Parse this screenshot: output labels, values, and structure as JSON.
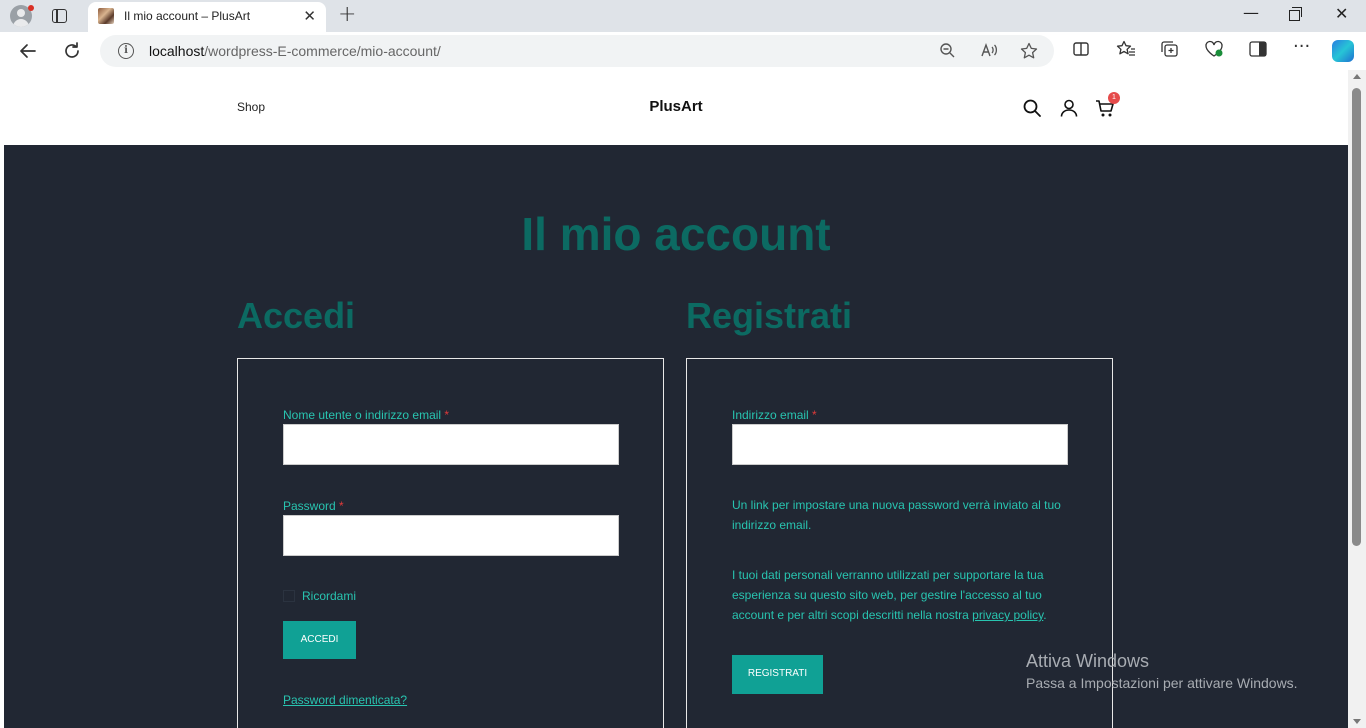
{
  "browser": {
    "tab_title": "Il mio account – PlusArt",
    "tab_close": "✕",
    "new_tab": "+",
    "url_host": "localhost",
    "url_path": "/wordpress-E-commerce/mio-account/",
    "window_controls": {
      "minimize": "—",
      "close": "✕"
    }
  },
  "site": {
    "nav": {
      "shop": "Shop"
    },
    "brand": "PlusArt",
    "cart_count": "1",
    "icons": [
      "search-icon",
      "user-icon",
      "cart-icon"
    ]
  },
  "page": {
    "title": "Il mio account",
    "login": {
      "heading": "Accedi",
      "username_label": "Nome utente o indirizzo email",
      "password_label": "Password",
      "required_mark": "*",
      "remember_label": "Ricordami",
      "submit_label": "ACCEDI",
      "lost_password": "Password dimenticata?"
    },
    "register": {
      "heading": "Registrati",
      "email_label": "Indirizzo email",
      "required_mark": "*",
      "password_note": "Un link per impostare una nuova password verrà inviato al tuo indirizzo email.",
      "privacy_text": "I tuoi dati personali verranno utilizzati per supportare la tua esperienza su questo sito web, per gestire l'accesso al tuo account e per altri scopi descritti nella nostra",
      "privacy_link": "privacy policy",
      "privacy_end": ".",
      "submit_label": "REGISTRATI"
    }
  },
  "watermark": {
    "title": "Attiva Windows",
    "subtitle": "Passa a Impostazioni per attivare Windows."
  },
  "colors": {
    "page_bg": "#212733",
    "heading": "#0c6a62",
    "label": "#28c4b0",
    "button": "#10a195",
    "required": "#e03a3a",
    "badge": "#e54b4b"
  }
}
